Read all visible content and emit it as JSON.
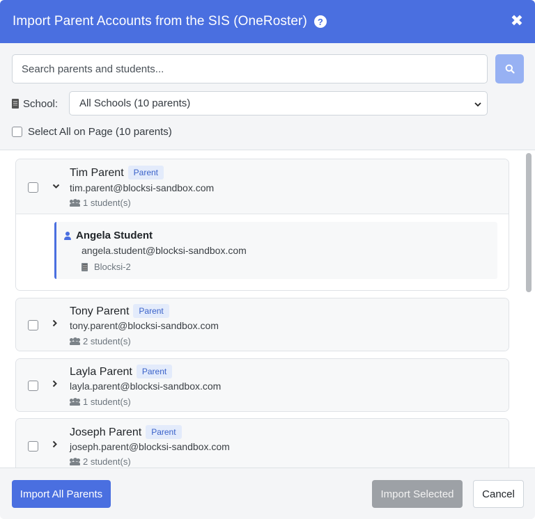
{
  "dialog": {
    "title": "Import Parent Accounts from the SIS (OneRoster)",
    "close_symbol": "✖",
    "help_symbol": "?"
  },
  "search": {
    "placeholder": "Search parents and students..."
  },
  "school_filter": {
    "label": "School:",
    "selected": "All Schools (10 parents)"
  },
  "select_all": {
    "label": "Select All on Page (10 parents)"
  },
  "parents": [
    {
      "name": "Tim Parent",
      "badge": "Parent",
      "email": "tim.parent@blocksi-sandbox.com",
      "students_count": "1 student(s)",
      "expanded": true,
      "students": [
        {
          "name": "Angela Student",
          "email": "angela.student@blocksi-sandbox.com",
          "school": "Blocksi-2"
        }
      ]
    },
    {
      "name": "Tony Parent",
      "badge": "Parent",
      "email": "tony.parent@blocksi-sandbox.com",
      "students_count": "2 student(s)",
      "expanded": false
    },
    {
      "name": "Layla Parent",
      "badge": "Parent",
      "email": "layla.parent@blocksi-sandbox.com",
      "students_count": "1 student(s)",
      "expanded": false
    },
    {
      "name": "Joseph Parent",
      "badge": "Parent",
      "email": "joseph.parent@blocksi-sandbox.com",
      "students_count": "2 student(s)",
      "expanded": false
    }
  ],
  "footer": {
    "import_all_label": "Import All Parents",
    "import_selected_label": "Import Selected",
    "cancel_label": "Cancel"
  },
  "colors": {
    "primary": "#4a6fe0",
    "search_button": "#97b1f3",
    "disabled_button": "#9da1a6",
    "badge_bg": "#e3ebfb",
    "badge_text": "#3a62c9"
  }
}
